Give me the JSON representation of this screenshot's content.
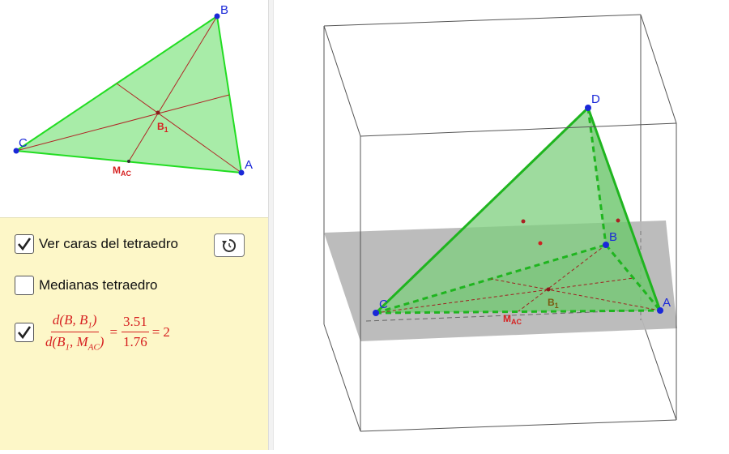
{
  "graphics2d": {
    "points": {
      "A": "A",
      "B": "B",
      "C": "C"
    },
    "centroid_label": "B",
    "centroid_sub": "1",
    "midpoint_label": "M",
    "midpoint_sub": "AC"
  },
  "algebra": {
    "checkbox_faces": {
      "label": "Ver caras del tetraedro",
      "checked": true
    },
    "checkbox_medians": {
      "label": "Medianas tetraedro",
      "checked": false
    },
    "checkbox_ratio": {
      "checked": true
    },
    "ratio": {
      "num_d": "d(B, B",
      "num_sub": "1",
      "num_close": ")",
      "den_d": "d(B",
      "den_sub1": "1",
      "den_mid": ", M",
      "den_sub2": "AC",
      "den_close": ")",
      "eq1": "=",
      "val_num": "3.51",
      "val_den": "1.76",
      "eq2": "=",
      "result": "2"
    },
    "reset_icon": "reset-icon"
  },
  "graphics3d": {
    "points": {
      "A": "A",
      "B": "B",
      "C": "C",
      "D": "D"
    },
    "centroid_label": "B",
    "centroid_sub": "1",
    "midpoint_label": "M",
    "midpoint_sub": "AC"
  },
  "colors": {
    "face_green": "#7ecf7e",
    "edge_green": "#22bb22",
    "point_blue": "#1a28d8",
    "median_red": "#aa2222",
    "label_red": "#d62020",
    "plane_gray": "#b8b8b8"
  }
}
